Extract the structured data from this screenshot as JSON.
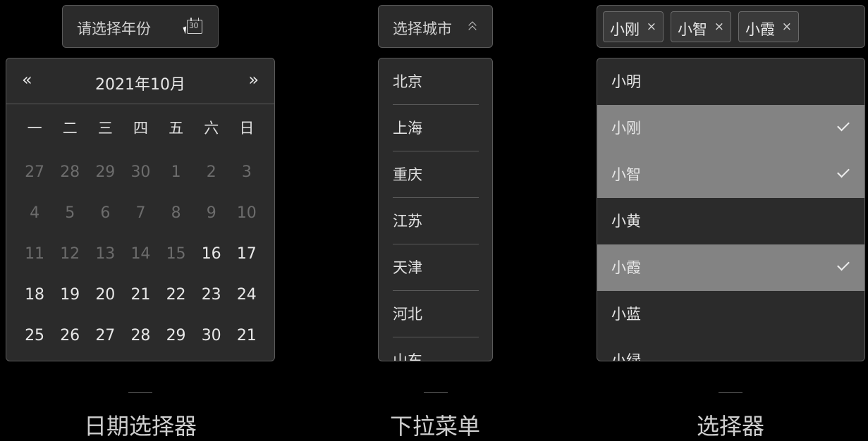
{
  "date_picker": {
    "placeholder": "请选择年份",
    "icon_text": "30",
    "prev_label": "«",
    "next_label": "»",
    "month_title": "2021年10月",
    "weekdays": [
      "一",
      "二",
      "三",
      "四",
      "五",
      "六",
      "日"
    ],
    "weeks": [
      [
        "27",
        "28",
        "29",
        "30",
        "1",
        "2",
        "3"
      ],
      [
        "4",
        "5",
        "6",
        "7",
        "8",
        "9",
        "10"
      ],
      [
        "11",
        "12",
        "13",
        "14",
        "15",
        "16",
        "17"
      ],
      [
        "18",
        "19",
        "20",
        "21",
        "22",
        "23",
        "24"
      ],
      [
        "25",
        "26",
        "27",
        "28",
        "29",
        "30",
        "21"
      ]
    ],
    "caption": "日期选择器"
  },
  "dropdown": {
    "placeholder": "选择城市",
    "items": [
      "北京",
      "上海",
      "重庆",
      "江苏",
      "天津",
      "河北",
      "山东"
    ],
    "caption": "下拉菜单"
  },
  "selector": {
    "tags": [
      "小刚",
      "小智",
      "小霞"
    ],
    "remove_glyph": "×",
    "options": [
      {
        "label": "小明",
        "selected": false
      },
      {
        "label": "小刚",
        "selected": true
      },
      {
        "label": "小智",
        "selected": true
      },
      {
        "label": "小黄",
        "selected": false
      },
      {
        "label": "小霞",
        "selected": true
      },
      {
        "label": "小蓝",
        "selected": false
      },
      {
        "label": "小绿",
        "selected": false
      }
    ],
    "caption": "选择器"
  }
}
